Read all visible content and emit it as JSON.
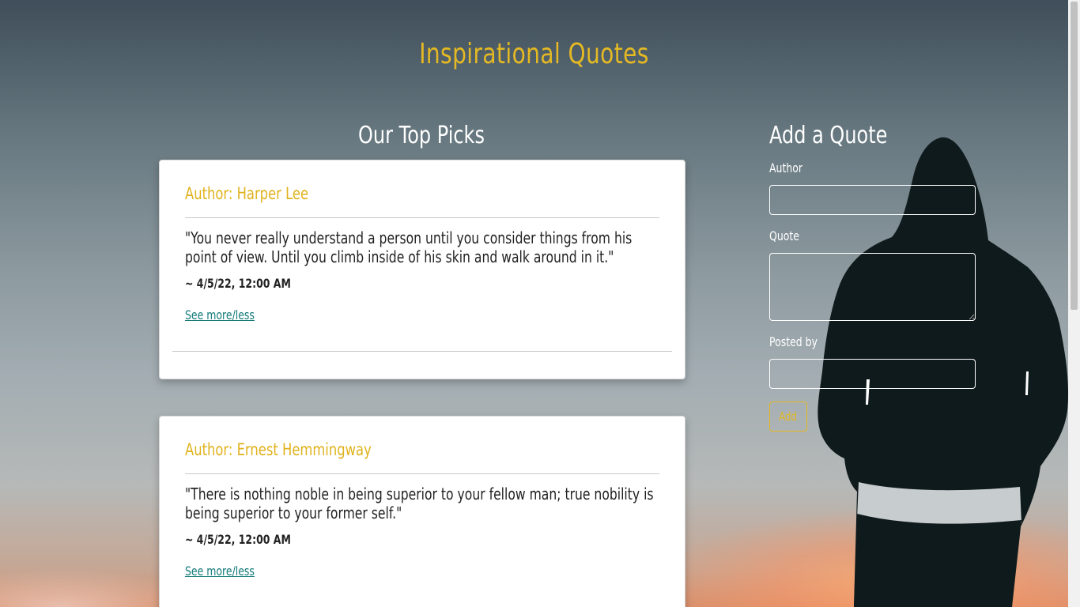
{
  "header": {
    "title": "Inspirational Quotes"
  },
  "picks": {
    "title": "Our Top Picks",
    "cards": [
      {
        "author": "Author: Harper Lee",
        "quote": "\"You never really understand a person until you consider things from his point of view. Until you climb inside of his skin and walk around in it.\"",
        "date": "~ 4/5/22, 12:00 AM",
        "link": "See more/less"
      },
      {
        "author": "Author: Ernest Hemmingway",
        "quote": "\"There is nothing noble in being superior to your fellow man; true nobility is being superior to your former self.\"",
        "date": "~ 4/5/22, 12:00 AM",
        "link": "See more/less"
      }
    ]
  },
  "form": {
    "title": "Add a Quote",
    "author_label": "Author",
    "author_value": "",
    "quote_label": "Quote",
    "quote_value": "",
    "posted_by_label": "Posted by",
    "posted_by_value": "",
    "submit_label": "Add"
  },
  "colors": {
    "accent": "#e5b923",
    "link": "#157a7a",
    "card_bg": "#ffffff"
  }
}
